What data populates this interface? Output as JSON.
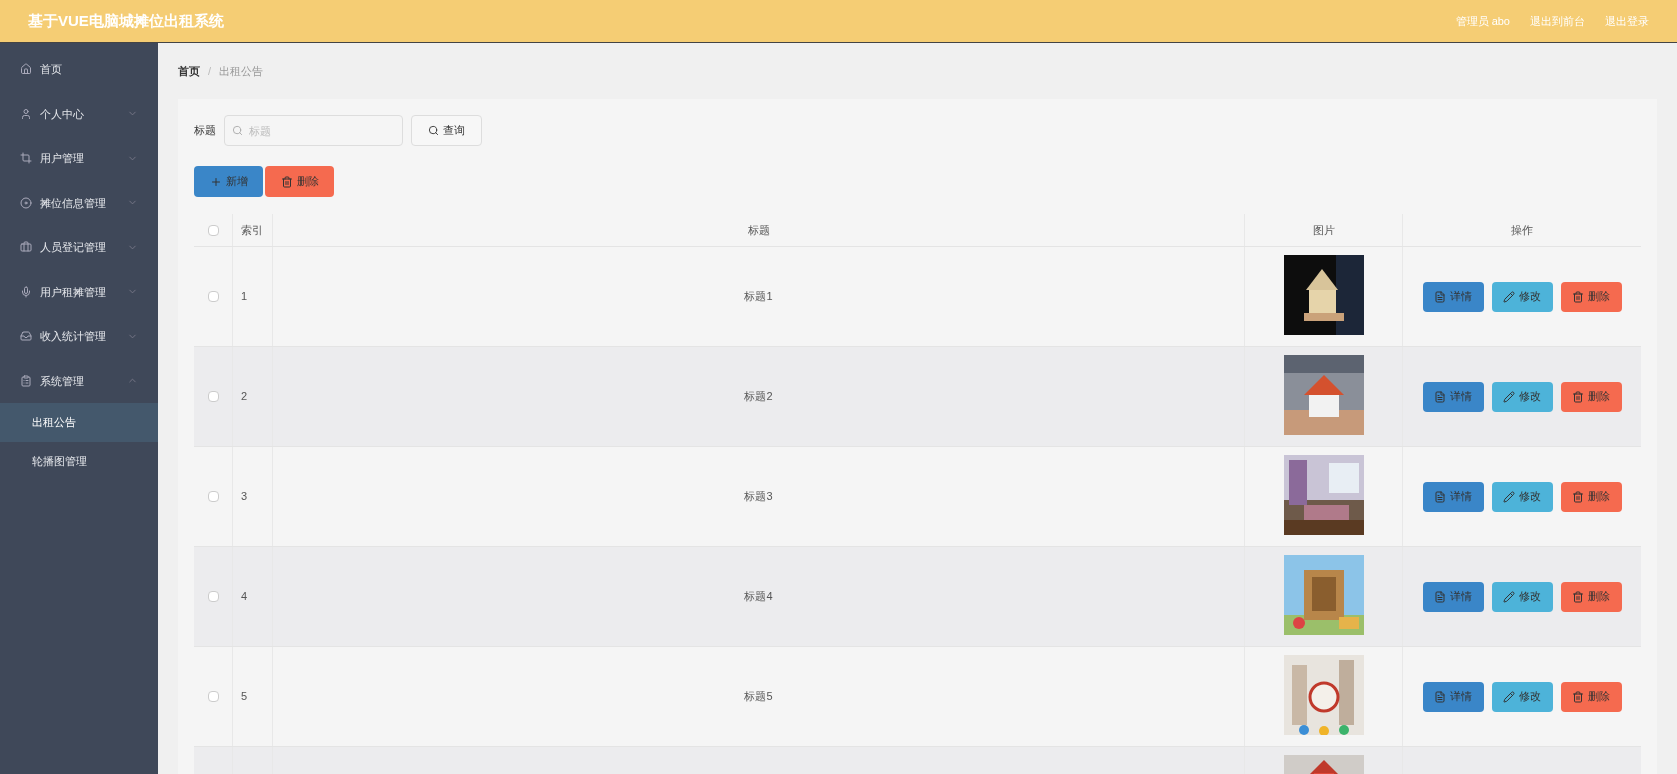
{
  "header": {
    "title": "基于VUE电脑城摊位出租系统",
    "links": [
      "管理员 abo",
      "退出到前台",
      "退出登录"
    ]
  },
  "sidebar": {
    "items": [
      {
        "label": "首页"
      },
      {
        "label": "个人中心",
        "expanded": false
      },
      {
        "label": "用户管理",
        "expanded": false
      },
      {
        "label": "摊位信息管理",
        "expanded": false
      },
      {
        "label": "人员登记管理",
        "expanded": false
      },
      {
        "label": "用户租摊管理",
        "expanded": false
      },
      {
        "label": "收入统计管理",
        "expanded": false
      },
      {
        "label": "系统管理",
        "expanded": true,
        "children": [
          {
            "label": "出租公告",
            "selected": true
          },
          {
            "label": "轮播图管理",
            "selected": false
          }
        ]
      }
    ]
  },
  "breadcrumb": {
    "items": [
      "首页",
      "出租公告"
    ],
    "separator": "/"
  },
  "search": {
    "label": "标题",
    "placeholder": "标题",
    "button": "查询"
  },
  "actions": [
    {
      "label": "新增",
      "kind": "add"
    },
    {
      "label": "删除",
      "kind": "delete"
    }
  ],
  "table": {
    "columns": [
      "索引",
      "标题",
      "图片",
      "操作"
    ],
    "select_all_checked": false,
    "rows": [
      {
        "kind": "full",
        "index": "1",
        "title": "标题1",
        "checked": false,
        "actions": [
          {
            "label": "详情",
            "kind": "detail"
          },
          {
            "label": "修改",
            "kind": "edit"
          },
          {
            "label": "删除",
            "kind": "delete"
          }
        ]
      },
      {
        "kind": "full",
        "index": "2",
        "title": "标题2",
        "checked": false,
        "actions": [
          {
            "label": "详情",
            "kind": "detail"
          },
          {
            "label": "修改",
            "kind": "edit"
          },
          {
            "label": "删除",
            "kind": "delete"
          }
        ]
      },
      {
        "kind": "full",
        "index": "3",
        "title": "标题3",
        "checked": false,
        "actions": [
          {
            "label": "详情",
            "kind": "detail"
          },
          {
            "label": "修改",
            "kind": "edit"
          },
          {
            "label": "删除",
            "kind": "delete"
          }
        ]
      },
      {
        "kind": "full",
        "index": "4",
        "title": "标题4",
        "checked": false,
        "actions": [
          {
            "label": "详情",
            "kind": "detail"
          },
          {
            "label": "修改",
            "kind": "edit"
          },
          {
            "label": "删除",
            "kind": "delete"
          }
        ]
      },
      {
        "kind": "full",
        "index": "5",
        "title": "标题5",
        "checked": false,
        "actions": [
          {
            "label": "详情",
            "kind": "detail"
          },
          {
            "label": "修改",
            "kind": "edit"
          },
          {
            "label": "删除",
            "kind": "delete"
          }
        ]
      },
      {
        "kind": "partial"
      }
    ]
  }
}
